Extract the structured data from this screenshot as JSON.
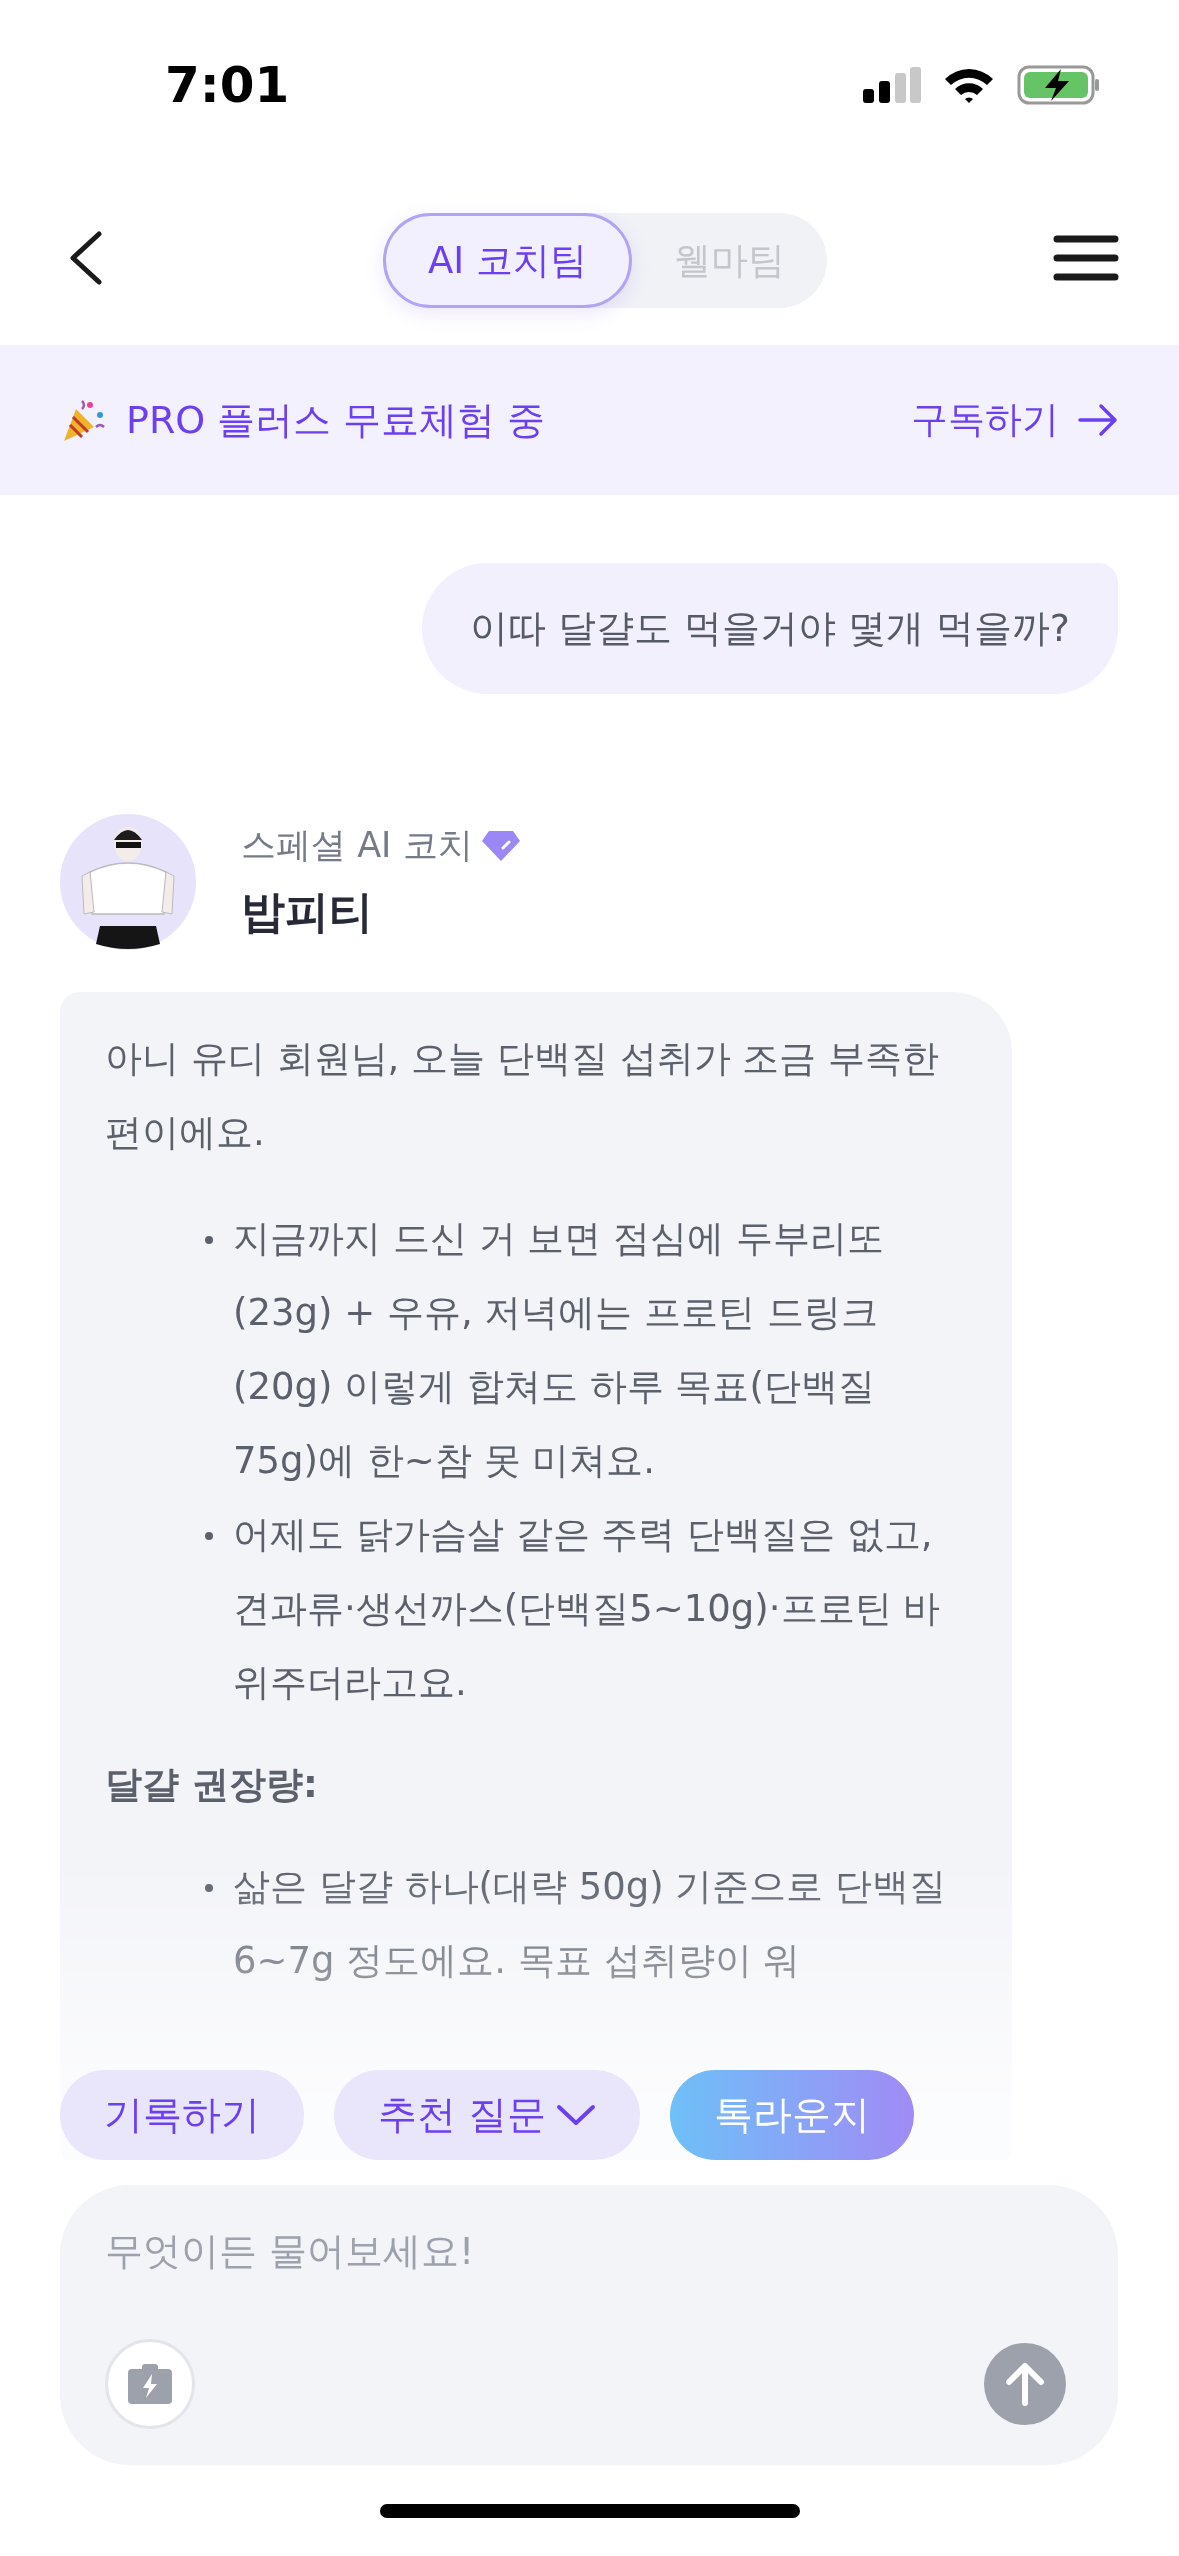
{
  "status_bar": {
    "time": "7:01"
  },
  "header": {
    "tabs": [
      {
        "label": "AI 코치팀",
        "selected": true
      },
      {
        "label": "웰마팀",
        "selected": false
      }
    ]
  },
  "banner": {
    "text": "PRO 플러스 무료체험 중",
    "action": "구독하기"
  },
  "messages": [
    {
      "kind": "user",
      "text": "이따 달걀도 먹을거야 몇개 먹을까?"
    },
    {
      "kind": "coach",
      "badge": "스페셜 AI 코치",
      "name": "밥피티",
      "blocks": [
        {
          "kind": "paragraph",
          "text": "아니 유디 회원님, 오늘 단백질 섭취가 조금 부족한 편이에요."
        },
        {
          "kind": "list",
          "items": [
            "지금까지 드신 거 보면 점심에 두부리또(23g) + 우유, 저녁에는 프로틴 드링크(20g) 이렇게 합쳐도 하루 목표(단백질 75g)에 한~참 못 미쳐요.",
            "어제도 닭가슴살 같은 주력 단백질은 없고, 견과류·생선까스(단백질5~10g)·프로틴 바 위주더라고요."
          ]
        },
        {
          "kind": "heading",
          "text": "달걀 권장량:"
        },
        {
          "kind": "list",
          "items": [
            "삶은 달걀 하나(대략 50g) 기준으로 단백질 6~7g 정도에요. 목표 섭취량이 워"
          ]
        }
      ]
    }
  ],
  "quick_actions": [
    {
      "kind": "chip",
      "label": "기록하기"
    },
    {
      "kind": "dropdown",
      "label": "추천 질문"
    },
    {
      "kind": "gradient",
      "label": "톡라운지"
    }
  ],
  "composer": {
    "placeholder": "무엇이든 물어보세요!"
  }
}
